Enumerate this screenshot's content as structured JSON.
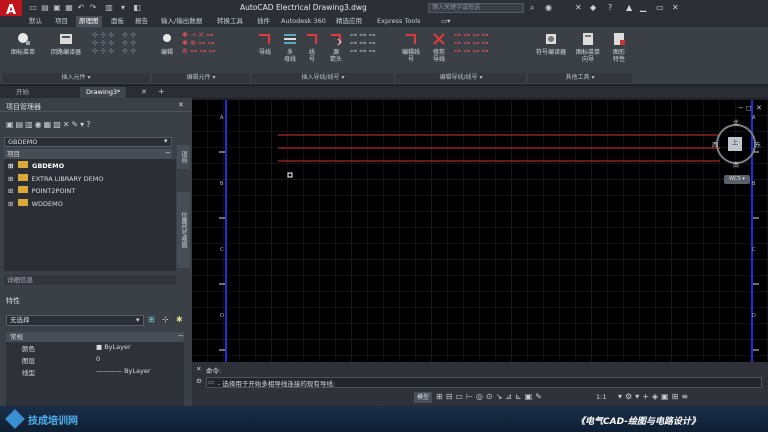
{
  "app": {
    "logo": "A",
    "title": "AutoCAD Electrical    Drawing3.dwg",
    "search_placeholder": "键入关键字或短语"
  },
  "ribbon_tabs": [
    "默认",
    "项目",
    "原理图",
    "面板",
    "报告",
    "输入/输出数据",
    "转换工具",
    "插件",
    "Autodesk 360",
    "精选应用",
    "Express Tools"
  ],
  "ribbon_active_tab": 2,
  "ribbon": {
    "buttons": [
      "图标菜单",
      "回路编译器",
      "编辑",
      "导线",
      "多\n母线",
      "线\n号",
      "源\n箭头",
      "编辑线\n号",
      "修剪\n导线",
      "符号编译器",
      "图标菜单\n向导",
      "图形\n特性"
    ],
    "groups": [
      "插入元件 ▾",
      "编辑元件 ▾",
      "插入导线/线号 ▾",
      "编辑导线/线号 ▾",
      "其他工具 ▾"
    ]
  },
  "doc_tabs": [
    "开始",
    "Drawing3*"
  ],
  "project_manager": {
    "title": "项目管理器",
    "project_select": "GBDEMO",
    "header": "项目",
    "projects": [
      "GBDEMO",
      "EXTRA LIBRARY DEMO",
      "POINT2POINT",
      "WDDEMO"
    ],
    "side_label_1": "项目",
    "side_label_2": "位置代号视图",
    "details": "详细信息"
  },
  "properties": {
    "title": "特性",
    "selection": "无选择",
    "section": "常规",
    "fields": [
      {
        "label": "颜色",
        "value": "■ ByLayer"
      },
      {
        "label": "图层",
        "value": "0"
      },
      {
        "label": "线型",
        "value": "———— ByLayer"
      }
    ]
  },
  "canvas": {
    "ladder_labels": [
      "A",
      "B",
      "C",
      "D"
    ],
    "viewcube": {
      "north": "北",
      "south": "南",
      "east": "东",
      "west": "西",
      "center": "上",
      "wcs": "WCS ▾"
    }
  },
  "command": {
    "label": "命令:",
    "prompt": "- 选择用于开始多相导线连接的现有导线:"
  },
  "status": {
    "model": "模型",
    "scale": "1:1"
  },
  "footer": {
    "left_logo": "技成培训网",
    "right_caption": "《电气CAD-绘图与电路设计》"
  }
}
